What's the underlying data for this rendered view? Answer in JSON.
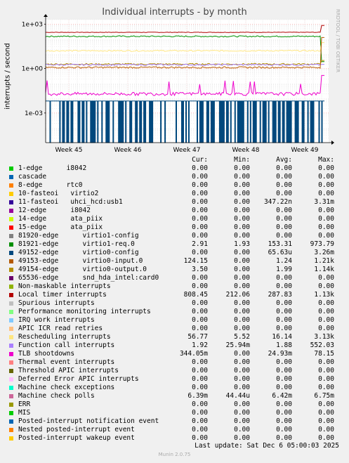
{
  "title": "Individual interrupts - by month",
  "watermark": "RRDTOOL / TOBI OETIKER",
  "footer": "Munin 2.0.75",
  "last_update": "Last update: Sat Dec  6 05:00:03 2025",
  "legend_headers": {
    "cur": "Cur:",
    "min": "Min:",
    "avg": "Avg:",
    "max": "Max:"
  },
  "legend": [
    {
      "name": "1-edge      i8042",
      "color": "#00cc00",
      "cur": "0.00",
      "min": "0.00",
      "avg": "0.00",
      "max": "0.00"
    },
    {
      "name": "cascade",
      "color": "#0066b3",
      "cur": "0.00",
      "min": "0.00",
      "avg": "0.00",
      "max": "0.00"
    },
    {
      "name": "8-edge      rtc0",
      "color": "#ff8000",
      "cur": "0.00",
      "min": "0.00",
      "avg": "0.00",
      "max": "0.00"
    },
    {
      "name": "10-fasteoi   virtio2",
      "color": "#ffcc00",
      "cur": "0.00",
      "min": "0.00",
      "avg": "0.00",
      "max": "0.00"
    },
    {
      "name": "11-fasteoi   uhci_hcd:usb1",
      "color": "#330099",
      "cur": "0.00",
      "min": "0.00",
      "avg": "347.22n",
      "max": "3.31m"
    },
    {
      "name": "12-edge      i8042",
      "color": "#990099",
      "cur": "0.00",
      "min": "0.00",
      "avg": "0.00",
      "max": "0.00"
    },
    {
      "name": "14-edge      ata_piix",
      "color": "#ccff00",
      "cur": "0.00",
      "min": "0.00",
      "avg": "0.00",
      "max": "0.00"
    },
    {
      "name": "15-edge      ata_piix",
      "color": "#ff0000",
      "cur": "0.00",
      "min": "0.00",
      "avg": "0.00",
      "max": "0.00"
    },
    {
      "name": "81920-edge      virtio1-config",
      "color": "#808080",
      "cur": "0.00",
      "min": "0.00",
      "avg": "0.00",
      "max": "0.00"
    },
    {
      "name": "81921-edge      virtio1-req.0",
      "color": "#008f00",
      "cur": "2.91",
      "min": "1.93",
      "avg": "153.31",
      "max": "973.79"
    },
    {
      "name": "49152-edge      virtio0-config",
      "color": "#00487d",
      "cur": "0.00",
      "min": "0.00",
      "avg": "65.63u",
      "max": "3.26m"
    },
    {
      "name": "49153-edge      virtio0-input.0",
      "color": "#b35a00",
      "cur": "124.15",
      "min": "0.00",
      "avg": "1.24",
      "max": "1.21k"
    },
    {
      "name": "49154-edge      virtio0-output.0",
      "color": "#b38f00",
      "cur": "3.50",
      "min": "0.00",
      "avg": "1.99",
      "max": "1.14k"
    },
    {
      "name": "65536-edge      snd_hda_intel:card0",
      "color": "#6b006b",
      "cur": "0.00",
      "min": "0.00",
      "avg": "0.00",
      "max": "0.00"
    },
    {
      "name": "Non-maskable interrupts",
      "color": "#8fb300",
      "cur": "0.00",
      "min": "0.00",
      "avg": "0.00",
      "max": "0.00"
    },
    {
      "name": "Local timer interrupts",
      "color": "#b30000",
      "cur": "808.45",
      "min": "212.06",
      "avg": "287.83",
      "max": "1.13k"
    },
    {
      "name": "Spurious interrupts",
      "color": "#bebebe",
      "cur": "0.00",
      "min": "0.00",
      "avg": "0.00",
      "max": "0.00"
    },
    {
      "name": "Performance monitoring interrupts",
      "color": "#80ff80",
      "cur": "0.00",
      "min": "0.00",
      "avg": "0.00",
      "max": "0.00"
    },
    {
      "name": "IRQ work interrupts",
      "color": "#80c9ff",
      "cur": "0.00",
      "min": "0.00",
      "avg": "0.00",
      "max": "0.00"
    },
    {
      "name": "APIC ICR read retries",
      "color": "#ffc080",
      "cur": "0.00",
      "min": "0.00",
      "avg": "0.00",
      "max": "0.00"
    },
    {
      "name": "Rescheduling interrupts",
      "color": "#ffe680",
      "cur": "56.77",
      "min": "5.52",
      "avg": "16.14",
      "max": "3.13k"
    },
    {
      "name": "Function call interrupts",
      "color": "#aa80ff",
      "cur": "1.92",
      "min": "25.94m",
      "avg": "1.88",
      "max": "552.03"
    },
    {
      "name": "TLB shootdowns",
      "color": "#ee00cc",
      "cur": "344.05m",
      "min": "0.00",
      "avg": "24.93m",
      "max": "78.15"
    },
    {
      "name": "Thermal event interrupts",
      "color": "#ff8080",
      "cur": "0.00",
      "min": "0.00",
      "avg": "0.00",
      "max": "0.00"
    },
    {
      "name": "Threshold APIC interrupts",
      "color": "#666600",
      "cur": "0.00",
      "min": "0.00",
      "avg": "0.00",
      "max": "0.00"
    },
    {
      "name": "Deferred Error APIC interrupts",
      "color": "#ffbfff",
      "cur": "0.00",
      "min": "0.00",
      "avg": "0.00",
      "max": "0.00"
    },
    {
      "name": "Machine check exceptions",
      "color": "#00ffcc",
      "cur": "0.00",
      "min": "0.00",
      "avg": "0.00",
      "max": "0.00"
    },
    {
      "name": "Machine check polls",
      "color": "#cc6699",
      "cur": "6.39m",
      "min": "44.44u",
      "avg": "6.42m",
      "max": "6.75m"
    },
    {
      "name": "ERR",
      "color": "#999900",
      "cur": "0.00",
      "min": "0.00",
      "avg": "0.00",
      "max": "0.00"
    },
    {
      "name": "MIS",
      "color": "#00cc00",
      "cur": "0.00",
      "min": "0.00",
      "avg": "0.00",
      "max": "0.00"
    },
    {
      "name": "Posted-interrupt notification event",
      "color": "#0066b3",
      "cur": "0.00",
      "min": "0.00",
      "avg": "0.00",
      "max": "0.00"
    },
    {
      "name": "Nested posted-interrupt event",
      "color": "#ff8000",
      "cur": "0.00",
      "min": "0.00",
      "avg": "0.00",
      "max": "0.00"
    },
    {
      "name": "Posted-interrupt wakeup event",
      "color": "#ffcc00",
      "cur": "0.00",
      "min": "0.00",
      "avg": "0.00",
      "max": "0.00"
    }
  ],
  "chart_data": {
    "type": "line",
    "title": "Individual interrupts - by month",
    "ylabel": "interrupts / second",
    "y_scale": "log",
    "ylim": [
      1e-05,
      2000
    ],
    "y_ticks": [
      {
        "value": 1000,
        "label": "1e+03"
      },
      {
        "value": 1,
        "label": "1e+00"
      },
      {
        "value": 0.001,
        "label": "1e-03"
      }
    ],
    "x_ticks": [
      "Week 45",
      "Week 46",
      "Week 47",
      "Week 48",
      "Week 49"
    ],
    "grid": true,
    "series": [
      {
        "name": "Local timer interrupts",
        "color": "#b30000",
        "level": 280,
        "noise": 0.04,
        "end": 808.45
      },
      {
        "name": "81921-edge      virtio1-req.0",
        "color": "#008f00",
        "level": 150,
        "noise": 0.1,
        "end": 2.91
      },
      {
        "name": "Rescheduling interrupts",
        "color": "#ffe680",
        "level": 16,
        "noise": 0.1,
        "end": 56.77
      },
      {
        "name": "49154-edge      virtio0-output.0",
        "color": "#b38f00",
        "level": 2.0,
        "noise": 0.12,
        "end": 3.5
      },
      {
        "name": "Function call interrupts",
        "color": "#aa80ff",
        "level": 1.8,
        "noise": 0.12,
        "end": 1.92
      },
      {
        "name": "49153-edge      virtio0-input.0",
        "color": "#b35a00",
        "level": 1.2,
        "noise": 0.12,
        "end": 124.15
      },
      {
        "name": "TLB shootdowns",
        "color": "#ee00cc",
        "level": 0.02,
        "noise": 0.25,
        "end": 0.344
      },
      {
        "name": "Machine check polls",
        "color": "#00487d",
        "level": 0.0064,
        "noise": 0.0,
        "end": 0.0064,
        "style": "spike-to-zero"
      }
    ]
  }
}
